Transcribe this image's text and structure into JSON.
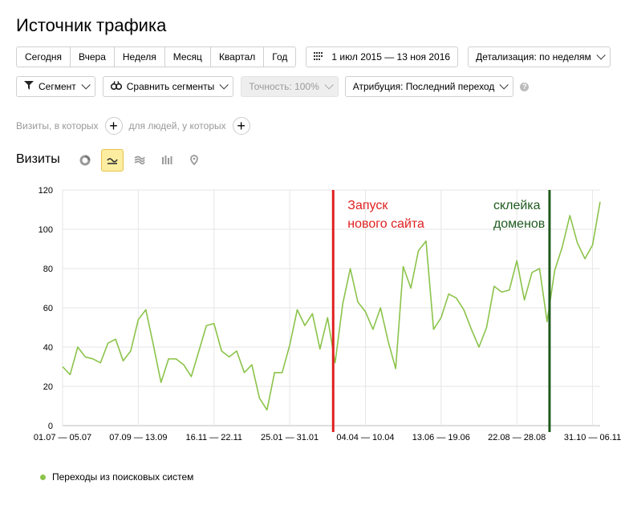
{
  "page": {
    "title": "Источник трафика"
  },
  "period_buttons": [
    "Сегодня",
    "Вчера",
    "Неделя",
    "Месяц",
    "Квартал",
    "Год"
  ],
  "date_range": "1 июл 2015 — 13 ноя 2016",
  "detail": "Детализация: по неделям",
  "controls": {
    "segment": "Сегмент",
    "compare": "Сравнить сегменты",
    "accuracy": "Точность: 100%",
    "attribution": "Атрибуция: Последний переход",
    "help": "?"
  },
  "filters": {
    "visits_who": "Визиты, в которых",
    "people_who": "для людей, у которых"
  },
  "chart_section": {
    "label": "Визиты"
  },
  "chart_data": {
    "type": "line",
    "x_labels": [
      "01.07 — 05.07",
      "07.09 — 13.09",
      "16.11 — 22.11",
      "25.01 — 31.01",
      "04.04 — 10.04",
      "13.06 — 19.06",
      "22.08 — 28.08",
      "31.10 — 06.11"
    ],
    "ylim": [
      0,
      120
    ],
    "yticks": [
      0,
      20,
      40,
      60,
      80,
      100,
      120
    ],
    "series": [
      {
        "name": "Переходы из поисковых систем",
        "color": "#8bc34a",
        "values": [
          30,
          26,
          40,
          35,
          34,
          32,
          42,
          44,
          33,
          38,
          54,
          59,
          41,
          22,
          34,
          34,
          31,
          25,
          38,
          51,
          52,
          38,
          35,
          38,
          27,
          31,
          14,
          8,
          27,
          27,
          41,
          59,
          51,
          57,
          39,
          55,
          32,
          62,
          80,
          63,
          58,
          49,
          60,
          43,
          29,
          81,
          70,
          89,
          94,
          49,
          55,
          67,
          65,
          59,
          49,
          40,
          50,
          71,
          68,
          69,
          84,
          64,
          78,
          80,
          53,
          79,
          91,
          107,
          93,
          85,
          92,
          114
        ]
      }
    ],
    "annotations": [
      {
        "text_line1": "Запуск",
        "text_line2": "нового сайта",
        "color": "#e02020",
        "x_index": 35
      },
      {
        "text_line1": "склейка",
        "text_line2": "доменов",
        "color": "#1f5a1f",
        "x_index": 64
      }
    ],
    "grid": true,
    "legend": "bottom-left"
  }
}
